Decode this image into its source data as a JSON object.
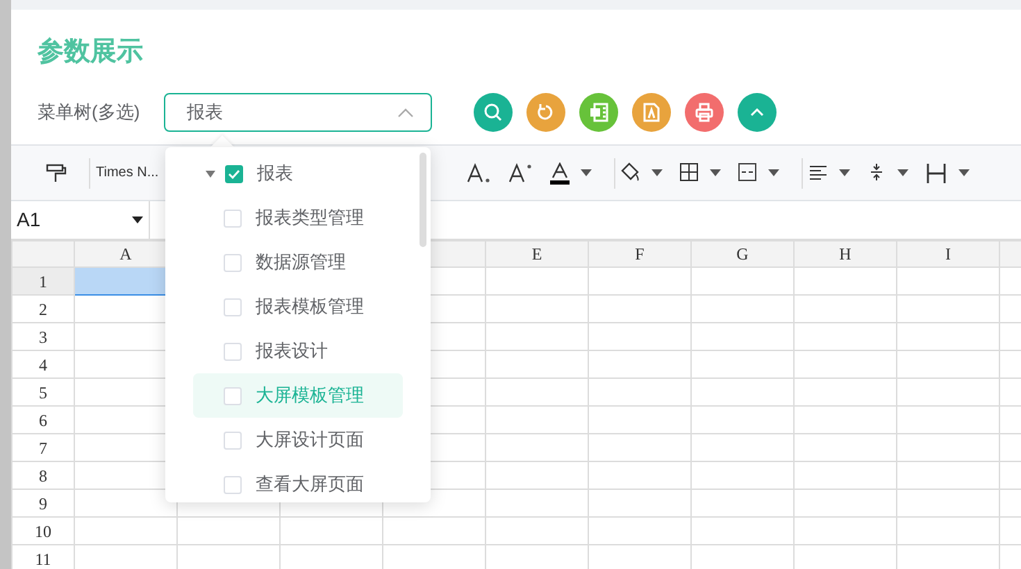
{
  "page_title": "参数展示",
  "menu_tree": {
    "label": "菜单树(多选)",
    "value": "报表",
    "open": true
  },
  "action_buttons": [
    {
      "kind": "search",
      "color": "#1ab394"
    },
    {
      "kind": "refresh",
      "color": "#e8a33d"
    },
    {
      "kind": "excel",
      "color": "#67c23a"
    },
    {
      "kind": "pdf",
      "color": "#e8a33d"
    },
    {
      "kind": "print",
      "color": "#f26d6d"
    },
    {
      "kind": "collapse",
      "color": "#1ab394"
    }
  ],
  "toolbar": [
    {
      "kind": "paint-format"
    },
    {
      "kind": "divider"
    },
    {
      "kind": "font",
      "label": "Times N..."
    },
    {
      "kind": "subscript"
    },
    {
      "kind": "superscript"
    },
    {
      "kind": "font-color",
      "dropdown": true
    },
    {
      "kind": "divider"
    },
    {
      "kind": "fill-color",
      "dropdown": true
    },
    {
      "kind": "border",
      "dropdown": true
    },
    {
      "kind": "merge",
      "dropdown": true
    },
    {
      "kind": "divider"
    },
    {
      "kind": "align",
      "dropdown": true
    },
    {
      "kind": "valign",
      "dropdown": true
    },
    {
      "kind": "wrap",
      "dropdown": true
    }
  ],
  "name_box": "A1",
  "sheet": {
    "columns": [
      "A",
      null,
      null,
      null,
      "E",
      "F",
      "G",
      "H",
      "I"
    ],
    "rows": [
      {
        "label": "1",
        "selected": true
      },
      {
        "label": "2",
        "selected": false
      },
      {
        "label": "3",
        "selected": false
      },
      {
        "label": "4",
        "selected": false
      },
      {
        "label": "5",
        "selected": false
      },
      {
        "label": "6",
        "selected": false
      },
      {
        "label": "7",
        "selected": false
      },
      {
        "label": "8",
        "selected": false
      },
      {
        "label": "9",
        "selected": false
      },
      {
        "label": "10",
        "selected": false
      },
      {
        "label": "11",
        "selected": false
      }
    ]
  },
  "tree": [
    {
      "label": "报表",
      "checked": true,
      "expanded": true,
      "highlighted": false,
      "children": [
        {
          "label": "报表类型管理",
          "checked": false,
          "highlighted": false
        },
        {
          "label": "数据源管理",
          "checked": false,
          "highlighted": false
        },
        {
          "label": "报表模板管理",
          "checked": false,
          "highlighted": false
        },
        {
          "label": "报表设计",
          "checked": false,
          "highlighted": false
        },
        {
          "label": "大屏模板管理",
          "checked": false,
          "highlighted": true
        },
        {
          "label": "大屏设计页面",
          "checked": false,
          "highlighted": false
        },
        {
          "label": "查看大屏页面",
          "checked": false,
          "highlighted": false
        }
      ]
    }
  ]
}
